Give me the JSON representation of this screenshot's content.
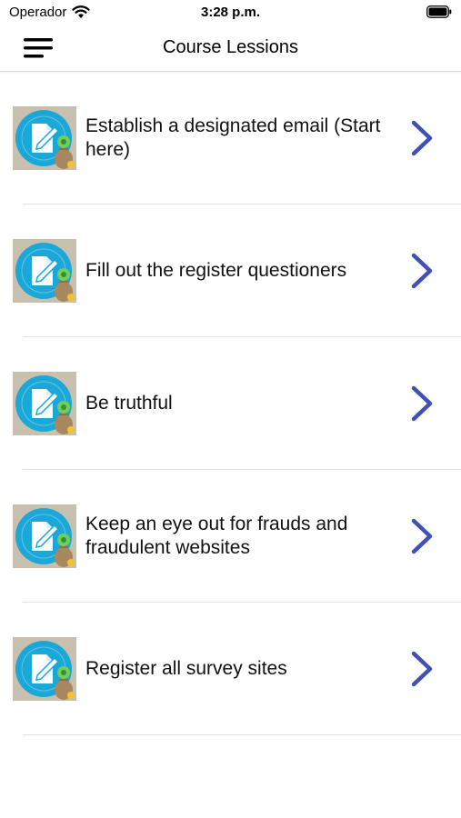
{
  "status_bar": {
    "carrier": "Operador",
    "time": "3:28 p.m.",
    "wifi_icon": "wifi-icon",
    "battery_icon": "battery-icon"
  },
  "nav": {
    "title": "Course Lessions",
    "menu_icon": "hamburger-menu-icon"
  },
  "lessons": [
    {
      "label": "Establish a designated email (Start here)",
      "icon": "survey-money-icon"
    },
    {
      "label": "Fill out the register questioners",
      "icon": "survey-money-icon"
    },
    {
      "label": "Be truthful",
      "icon": "survey-money-icon"
    },
    {
      "label": "Keep an eye out for frauds and fraudulent websites",
      "icon": "survey-money-icon"
    },
    {
      "label": "Register all survey sites",
      "icon": "survey-money-icon"
    }
  ],
  "colors": {
    "accent": "#3f51b5",
    "thumb_bg": "#c7c0ae",
    "thumb_circle": "#1ba7d8"
  }
}
